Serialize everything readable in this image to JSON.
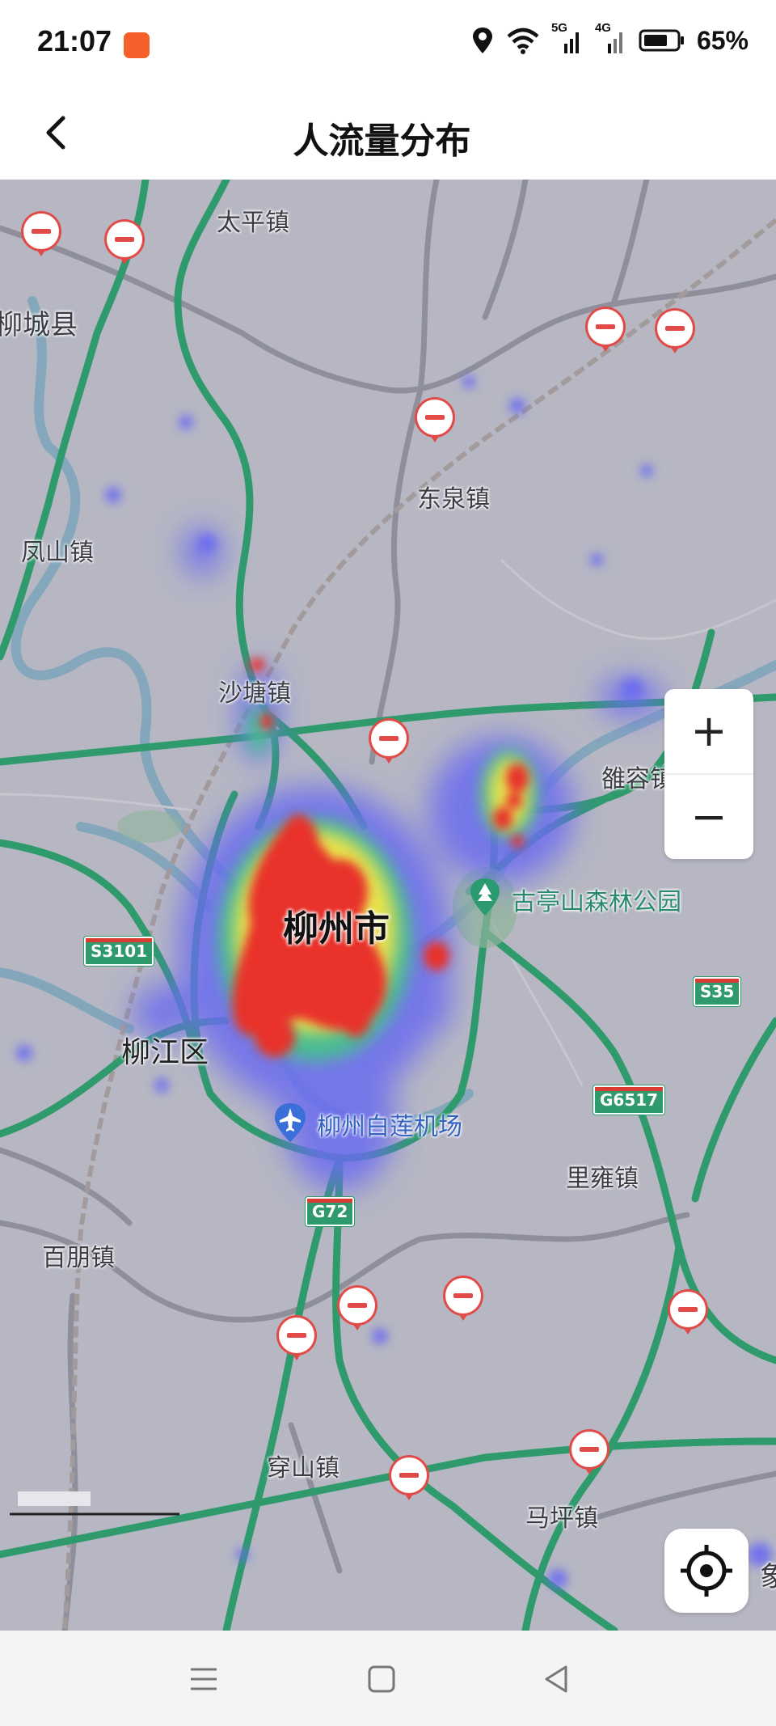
{
  "status_bar": {
    "time": "21:07",
    "network_5g": "5G",
    "network_4g": "4G",
    "battery": "65%"
  },
  "header": {
    "title": "人流量分布"
  },
  "map": {
    "places": {
      "taiping": "太平镇",
      "liucheng": "柳城县",
      "dongquan": "东泉镇",
      "fengshan": "凤山镇",
      "shatang": "沙塘镇",
      "luorong": "雒容镇",
      "liuzhou": "柳州市",
      "gutingshan": "古亭山森林公园",
      "liujiang": "柳江区",
      "airport": "柳州白莲机场",
      "liyong": "里雍镇",
      "baipeng": "百朋镇",
      "chuanshan": "穿山镇",
      "maping": "马坪镇",
      "xiang": "象"
    },
    "road_shields": {
      "s3101": "S3101",
      "s35": "S35",
      "g6517": "G6517",
      "g72": "G72"
    },
    "colors": {
      "background": "#b6b7c3",
      "highway": "#2f9a6c",
      "heat_high": "#e8322a",
      "heat_low": "#6a6cf0"
    }
  },
  "controls": {
    "zoom_in": "+",
    "zoom_out": "−"
  }
}
